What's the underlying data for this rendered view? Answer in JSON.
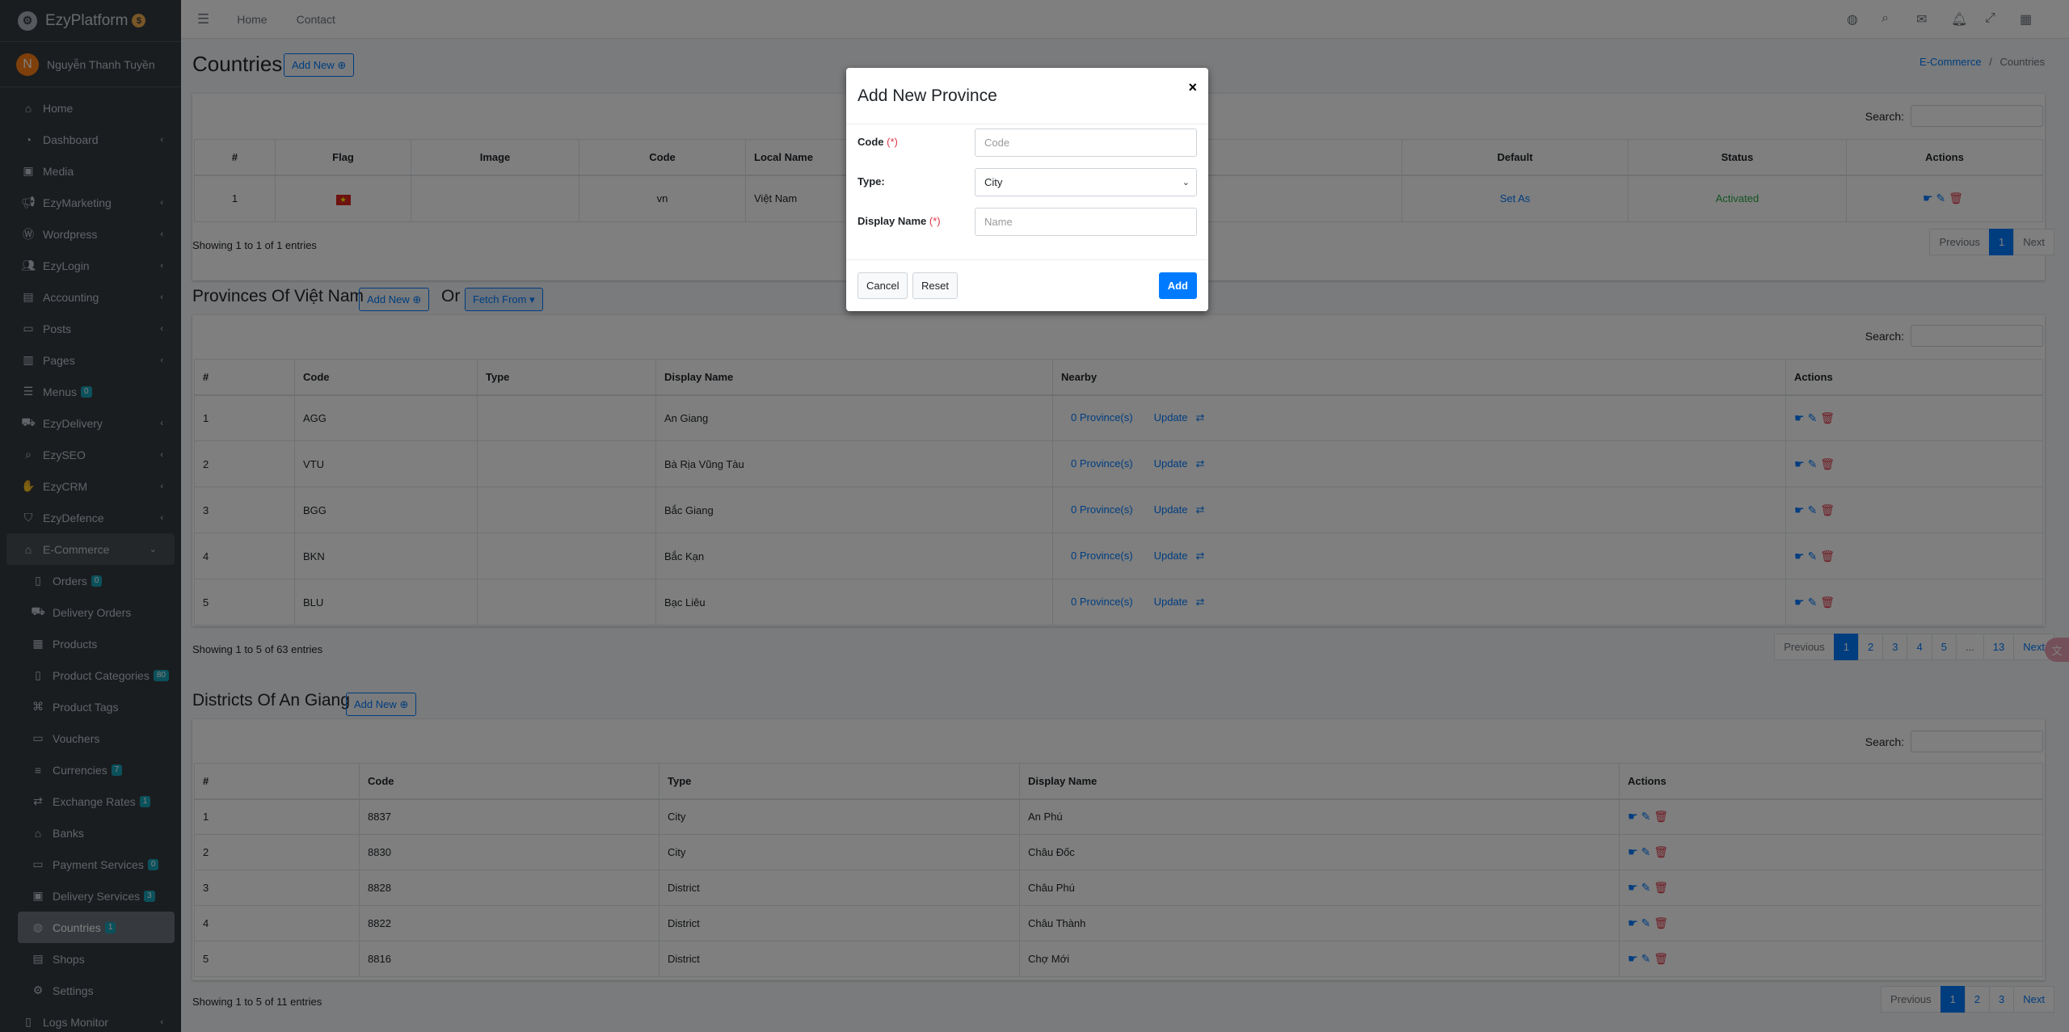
{
  "brand": {
    "name": "EzyPlatform",
    "coin_icon": "coin-icon"
  },
  "user": {
    "initial": "N",
    "name": "Nguyễn Thanh Tuyền"
  },
  "sidebar": {
    "items": [
      {
        "label": "Home",
        "icon": "home-icon",
        "caret": false
      },
      {
        "label": "Dashboard",
        "icon": "dashboard-icon",
        "caret": true
      },
      {
        "label": "Media",
        "icon": "media-icon",
        "caret": false
      },
      {
        "label": "EzyMarketing",
        "icon": "bullhorn-icon",
        "caret": true
      },
      {
        "label": "Wordpress",
        "icon": "wordpress-icon",
        "caret": true
      },
      {
        "label": "EzyLogin",
        "icon": "users-icon",
        "caret": true
      },
      {
        "label": "Accounting",
        "icon": "accounting-icon",
        "caret": true
      },
      {
        "label": "Posts",
        "icon": "posts-icon",
        "caret": true
      },
      {
        "label": "Pages",
        "icon": "pages-icon",
        "caret": true
      },
      {
        "label": "Menus",
        "icon": "menu-icon",
        "badge": "0"
      },
      {
        "label": "EzyDelivery",
        "icon": "truck-icon",
        "caret": true
      },
      {
        "label": "EzySEO",
        "icon": "search-icon",
        "caret": true
      },
      {
        "label": "EzyCRM",
        "icon": "handshake-icon",
        "caret": true
      },
      {
        "label": "EzyDefence",
        "icon": "shield-icon",
        "caret": true
      },
      {
        "label": "E-Commerce",
        "icon": "store-icon",
        "caret": true,
        "open": true
      },
      {
        "label": "Orders",
        "icon": "orders-icon",
        "badge": "0",
        "sub": true
      },
      {
        "label": "Delivery Orders",
        "icon": "delivery-orders-icon",
        "sub": true
      },
      {
        "label": "Products",
        "icon": "products-icon",
        "sub": true
      },
      {
        "label": "Product Categories",
        "icon": "categories-icon",
        "badge": "80",
        "sub": true
      },
      {
        "label": "Product Tags",
        "icon": "tags-icon",
        "sub": true
      },
      {
        "label": "Vouchers",
        "icon": "voucher-icon",
        "sub": true
      },
      {
        "label": "Currencies",
        "icon": "currency-icon",
        "badge": "7",
        "sub": true
      },
      {
        "label": "Exchange Rates",
        "icon": "exchange-icon",
        "badge": "1",
        "sub": true
      },
      {
        "label": "Banks",
        "icon": "bank-icon",
        "sub": true
      },
      {
        "label": "Payment Services",
        "icon": "payment-icon",
        "badge": "0",
        "sub": true
      },
      {
        "label": "Delivery Services",
        "icon": "delivery-icon",
        "badge": "3",
        "sub": true
      },
      {
        "label": "Countries",
        "icon": "globe-icon",
        "badge": "1",
        "sub": true,
        "active": true
      },
      {
        "label": "Shops",
        "icon": "shop-icon",
        "sub": true
      },
      {
        "label": "Settings",
        "icon": "settings-icon",
        "sub": true
      },
      {
        "label": "Logs Monitor",
        "icon": "logs-icon",
        "caret": true
      }
    ]
  },
  "topbar": {
    "links": [
      "Home",
      "Contact"
    ]
  },
  "countries": {
    "title": "Countries",
    "add_new": "Add New",
    "breadcrumb": [
      "E-Commerce",
      "/",
      "Countries"
    ],
    "search_label": "Search:",
    "headers": [
      "#",
      "Flag",
      "Image",
      "Code",
      "Local Name",
      "Default",
      "Status",
      "Actions"
    ],
    "rows": [
      {
        "num": "1",
        "flag": "★",
        "code": "vn",
        "local_name": "Việt Nam",
        "default": "Set As",
        "status": "Activated"
      }
    ],
    "info": "Showing 1 to 1 of 1 entries",
    "pagination": [
      "Previous",
      "1",
      "Next"
    ]
  },
  "provinces": {
    "title": "Provinces Of Việt Nam",
    "add_new": "Add New",
    "or": "Or",
    "fetch_from": "Fetch From",
    "search_label": "Search:",
    "headers": [
      "#",
      "Code",
      "Type",
      "Display Name",
      "Nearby",
      "Actions"
    ],
    "rows": [
      {
        "num": "1",
        "code": "AGG",
        "type": "",
        "name": "An Giang",
        "nearby": "0 Province(s)",
        "update": "Update"
      },
      {
        "num": "2",
        "code": "VTU",
        "type": "",
        "name": "Bà Rịa Vũng Tàu",
        "nearby": "0 Province(s)",
        "update": "Update"
      },
      {
        "num": "3",
        "code": "BGG",
        "type": "",
        "name": "Bắc Giang",
        "nearby": "0 Province(s)",
        "update": "Update"
      },
      {
        "num": "4",
        "code": "BKN",
        "type": "",
        "name": "Bắc Kạn",
        "nearby": "0 Province(s)",
        "update": "Update"
      },
      {
        "num": "5",
        "code": "BLU",
        "type": "",
        "name": "Bạc Liêu",
        "nearby": "0 Province(s)",
        "update": "Update"
      }
    ],
    "info": "Showing 1 to 5 of 63 entries",
    "pagination": [
      "Previous",
      "1",
      "2",
      "3",
      "4",
      "5",
      "...",
      "13",
      "Next"
    ]
  },
  "districts": {
    "title": "Districts Of An Giang",
    "add_new": "Add New",
    "search_label": "Search:",
    "headers": [
      "#",
      "Code",
      "Type",
      "Display Name",
      "Actions"
    ],
    "rows": [
      {
        "num": "1",
        "code": "8837",
        "type": "City",
        "name": "An Phú"
      },
      {
        "num": "2",
        "code": "8830",
        "type": "City",
        "name": "Châu Đốc"
      },
      {
        "num": "3",
        "code": "8828",
        "type": "District",
        "name": "Châu Phú"
      },
      {
        "num": "4",
        "code": "8822",
        "type": "District",
        "name": "Châu Thành"
      },
      {
        "num": "5",
        "code": "8816",
        "type": "District",
        "name": "Chợ Mới"
      }
    ],
    "info": "Showing 1 to 5 of 11 entries",
    "pagination": [
      "Previous",
      "1",
      "2",
      "3",
      "Next"
    ]
  },
  "modal": {
    "title": "Add New Province",
    "close": "×",
    "code_label": "Code",
    "required": "(*)",
    "code_placeholder": "Code",
    "type_label": "Type:",
    "type_value": "City",
    "name_label": "Display Name",
    "name_placeholder": "Name",
    "cancel": "Cancel",
    "reset": "Reset",
    "add": "Add"
  },
  "colors": {
    "primary": "#007bff",
    "danger": "#dc3545",
    "success": "#28a745",
    "sidebar": "#343a40"
  }
}
